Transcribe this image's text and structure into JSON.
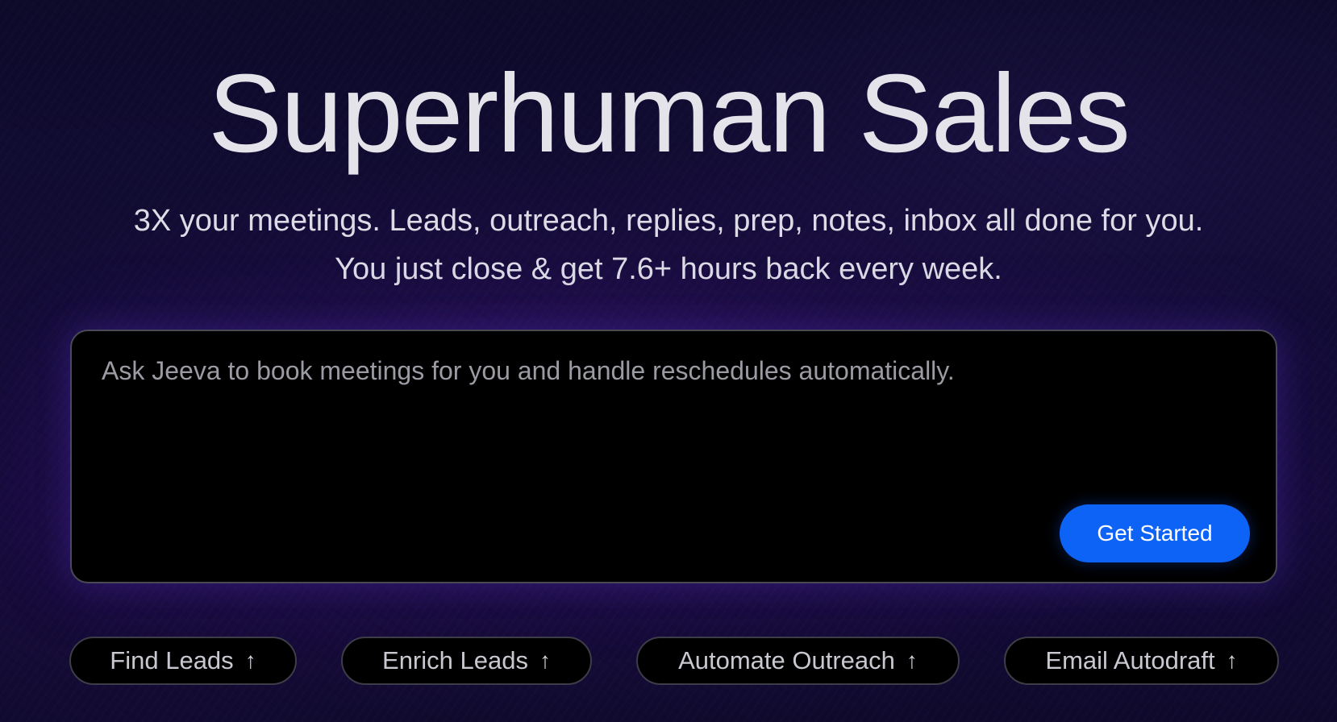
{
  "hero": {
    "title": "Superhuman Sales",
    "subtitle_line1": "3X your meetings. Leads, outreach, replies, prep, notes, inbox all done for you.",
    "subtitle_line2": "You just close & get 7.6+ hours back every week."
  },
  "prompt": {
    "placeholder": "Ask Jeeva to book meetings for you and handle reschedules automatically.",
    "value": "",
    "button_label": "Get Started"
  },
  "chips": [
    {
      "label": "Find Leads",
      "icon": "arrow-up-icon"
    },
    {
      "label": "Enrich Leads",
      "icon": "arrow-up-icon"
    },
    {
      "label": "Automate Outreach",
      "icon": "arrow-up-icon"
    },
    {
      "label": "Email Autodraft",
      "icon": "arrow-up-icon"
    }
  ],
  "colors": {
    "accent": "#0e63f7",
    "background": "#130c36",
    "panel": "#000000"
  }
}
